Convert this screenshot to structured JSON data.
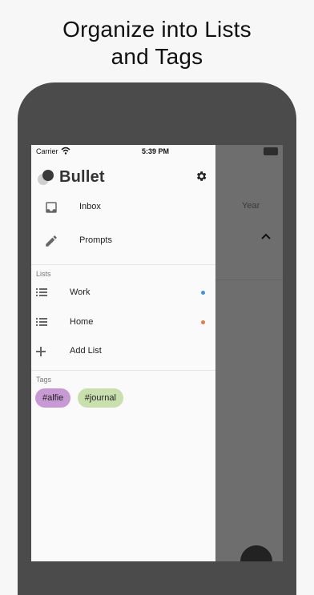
{
  "headline": {
    "line1": "Organize into Lists",
    "line2": "and Tags"
  },
  "status_bar": {
    "carrier": "Carrier",
    "time": "5:39 PM"
  },
  "app": {
    "name": "Bullet"
  },
  "nav": [
    {
      "label": "Inbox",
      "icon": "inbox-icon"
    },
    {
      "label": "Prompts",
      "icon": "pencil-icon"
    }
  ],
  "lists": {
    "header": "Lists",
    "items": [
      {
        "label": "Work",
        "color": "#4a90d9"
      },
      {
        "label": "Home",
        "color": "#e07a4f"
      }
    ],
    "add_label": "Add List"
  },
  "tags": {
    "header": "Tags",
    "items": [
      {
        "label": "#alfie",
        "color": "#c79ad6"
      },
      {
        "label": "#journal",
        "color": "#c9dfae"
      }
    ]
  },
  "background_view": {
    "year_label": "Year"
  }
}
